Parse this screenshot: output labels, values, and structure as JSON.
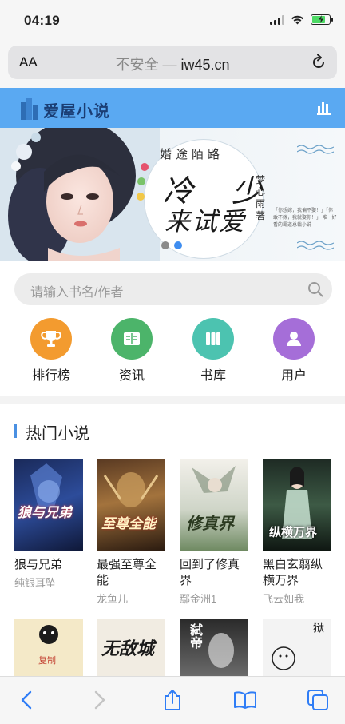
{
  "status": {
    "time": "04:19"
  },
  "browser": {
    "aa_label": "AA",
    "url_insecure": "不安全 —",
    "url_domain": "iw45.cn"
  },
  "site": {
    "title": "爱屋小说"
  },
  "banner": {
    "title": "婚途陌路",
    "big_line1": "冷 少",
    "big_line2": "来试爱",
    "author": "梦心雨著",
    "small_text": "「你想嫁，我偏不娶！」「你敢不嫁，我就娶你！」 唯一好看的霸道总裁小说",
    "dot_colors": [
      "#e5526d",
      "#7ac36a",
      "#f2c848",
      "#3e8df0",
      "#8a8a8a"
    ]
  },
  "search": {
    "placeholder": "请输入书名/作者"
  },
  "nav": [
    {
      "label": "排行榜",
      "icon": "trophy-icon",
      "color": "#f39b2f"
    },
    {
      "label": "资讯",
      "icon": "book-open-icon",
      "color": "#4cb46a"
    },
    {
      "label": "书库",
      "icon": "library-icon",
      "color": "#4cc3b0"
    },
    {
      "label": "用户",
      "icon": "user-icon",
      "color": "#a56ed8"
    }
  ],
  "hot": {
    "section_title": "热门小说",
    "books": [
      {
        "name": "狼与兄弟",
        "author": "纯银耳坠",
        "cover_title": "狼与兄弟"
      },
      {
        "name": "最强至尊全能",
        "author": "龙鱼儿",
        "cover_title": "至尊全能"
      },
      {
        "name": "回到了修真界",
        "author": "鄢金洲1",
        "cover_title": "修真界"
      },
      {
        "name": "黑白玄翦纵横万界",
        "author": "飞云如我",
        "cover_title": "纵横万界"
      }
    ],
    "row2_covers": [
      "复制",
      "无敌城",
      "弑帝",
      "狱"
    ]
  }
}
